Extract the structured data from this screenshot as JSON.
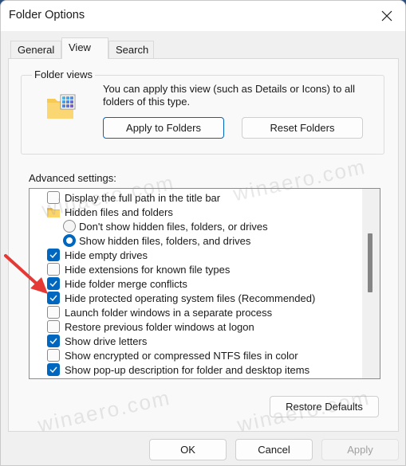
{
  "window": {
    "title": "Folder Options"
  },
  "tabs": [
    {
      "label": "General",
      "active": false
    },
    {
      "label": "View",
      "active": true
    },
    {
      "label": "Search",
      "active": false
    }
  ],
  "folder_views": {
    "label": "Folder views",
    "description": "You can apply this view (such as Details or Icons) to all folders of this type.",
    "apply_button": "Apply to Folders",
    "reset_button": "Reset Folders"
  },
  "advanced": {
    "label": "Advanced settings:",
    "items": [
      {
        "type": "checkbox",
        "label": "Display the full path in the title bar",
        "checked": false,
        "indent": 1
      },
      {
        "type": "folder",
        "label": "Hidden files and folders",
        "indent": 1
      },
      {
        "type": "radio",
        "label": "Don't show hidden files, folders, or drives",
        "checked": false,
        "indent": 2
      },
      {
        "type": "radio",
        "label": "Show hidden files, folders, and drives",
        "checked": true,
        "indent": 2
      },
      {
        "type": "checkbox",
        "label": "Hide empty drives",
        "checked": true,
        "indent": 1
      },
      {
        "type": "checkbox",
        "label": "Hide extensions for known file types",
        "checked": false,
        "indent": 1
      },
      {
        "type": "checkbox",
        "label": "Hide folder merge conflicts",
        "checked": true,
        "indent": 1
      },
      {
        "type": "checkbox",
        "label": "Hide protected operating system files (Recommended)",
        "checked": true,
        "indent": 1
      },
      {
        "type": "checkbox",
        "label": "Launch folder windows in a separate process",
        "checked": false,
        "indent": 1
      },
      {
        "type": "checkbox",
        "label": "Restore previous folder windows at logon",
        "checked": false,
        "indent": 1
      },
      {
        "type": "checkbox",
        "label": "Show drive letters",
        "checked": true,
        "indent": 1
      },
      {
        "type": "checkbox",
        "label": "Show encrypted or compressed NTFS files in color",
        "checked": false,
        "indent": 1
      },
      {
        "type": "checkbox",
        "label": "Show pop-up description for folder and desktop items",
        "checked": true,
        "indent": 1
      }
    ],
    "restore_defaults": "Restore Defaults"
  },
  "footer": {
    "ok": "OK",
    "cancel": "Cancel",
    "apply": "Apply"
  },
  "watermark": "winaero.com",
  "colors": {
    "accent": "#0067c0",
    "arrow": "#e53935"
  }
}
